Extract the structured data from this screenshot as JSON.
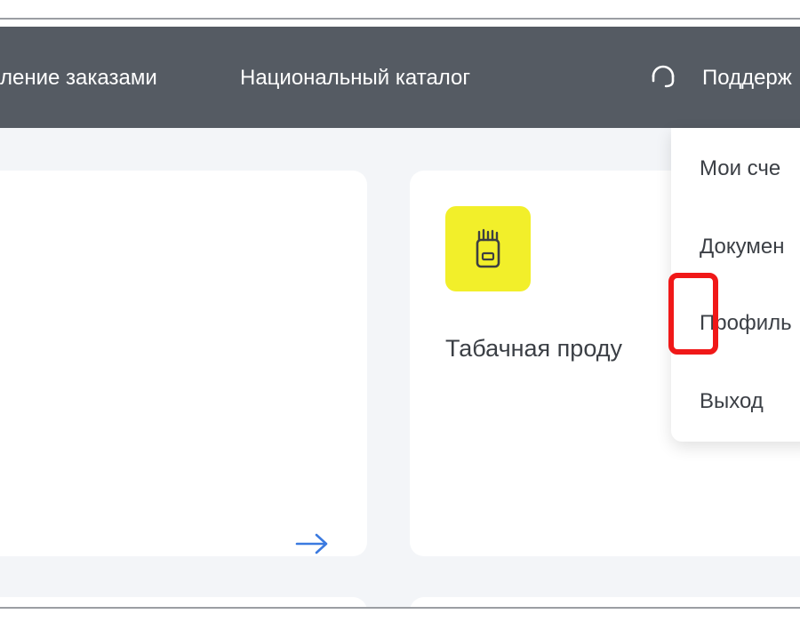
{
  "navbar": {
    "orders_label": "ление заказами",
    "catalog_label": "Национальный каталог",
    "support_icon": "headset-icon",
    "support_label": "Поддерж"
  },
  "cards": {
    "left_arrow_icon": "arrow-right-icon",
    "product_icon": "tobacco-pack-icon",
    "product_title": "Табачная проду"
  },
  "dropdown": {
    "items": [
      "Мои сче",
      "Докумен",
      "Профиль",
      "Выход"
    ]
  },
  "colors": {
    "navbar_bg": "#555b63",
    "page_bg": "#f3f5f8",
    "product_icon_bg": "#f2ef2a",
    "arrow": "#3b7ae0",
    "highlight": "#f01818"
  }
}
